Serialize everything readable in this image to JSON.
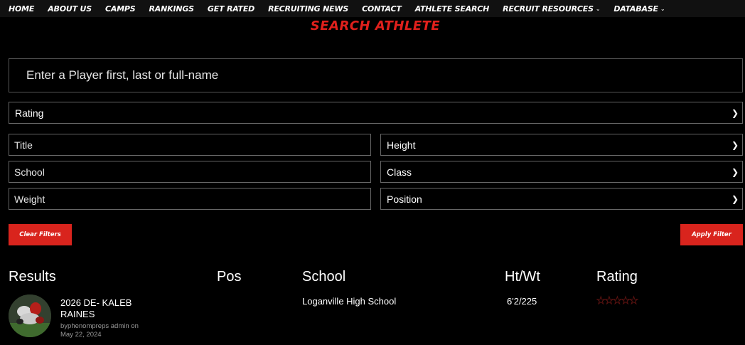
{
  "nav": {
    "items": [
      {
        "label": "HOME",
        "dropdown": false
      },
      {
        "label": "ABOUT US",
        "dropdown": false
      },
      {
        "label": "CAMPS",
        "dropdown": false
      },
      {
        "label": "RANKINGS",
        "dropdown": false
      },
      {
        "label": "GET RATED",
        "dropdown": false
      },
      {
        "label": "RECRUITING NEWS",
        "dropdown": false
      },
      {
        "label": "CONTACT",
        "dropdown": false
      },
      {
        "label": "ATHLETE SEARCH",
        "dropdown": false
      },
      {
        "label": "RECRUIT RESOURCES",
        "dropdown": true
      },
      {
        "label": "DATABASE",
        "dropdown": true
      }
    ]
  },
  "page": {
    "title": "SEARCH ATHLETE"
  },
  "search": {
    "placeholder": "Enter a Player first, last or full-name",
    "value": ""
  },
  "filters": {
    "rating": {
      "selected": "Rating"
    },
    "title": {
      "placeholder": "Title"
    },
    "height": {
      "selected": "Height"
    },
    "school": {
      "placeholder": "School"
    },
    "class": {
      "selected": "Class"
    },
    "weight": {
      "placeholder": "Weight"
    },
    "position": {
      "selected": "Position"
    }
  },
  "buttons": {
    "clear": "Clear Filters",
    "apply": "Apply Filter"
  },
  "results": {
    "headers": {
      "results": "Results",
      "pos": "Pos",
      "school": "School",
      "htwt": "Ht/Wt",
      "rating": "Rating"
    },
    "rows": [
      {
        "name": "2026 DE- KALEB RAINES",
        "author_line": "byphenompreps admin on",
        "date": "May 22, 2024",
        "pos": "",
        "school": "Loganville High School",
        "htwt": "6'2/225",
        "rating_stars": 0,
        "rating_max": 5
      }
    ]
  },
  "colors": {
    "accent": "#d9241d",
    "title_red": "#e0201c",
    "background": "#000000",
    "nav_bg": "#111111"
  },
  "icons": {
    "select_arrow": "chevron-down-icon",
    "rating": "star-icon",
    "submenu": "chevron-down-icon"
  }
}
